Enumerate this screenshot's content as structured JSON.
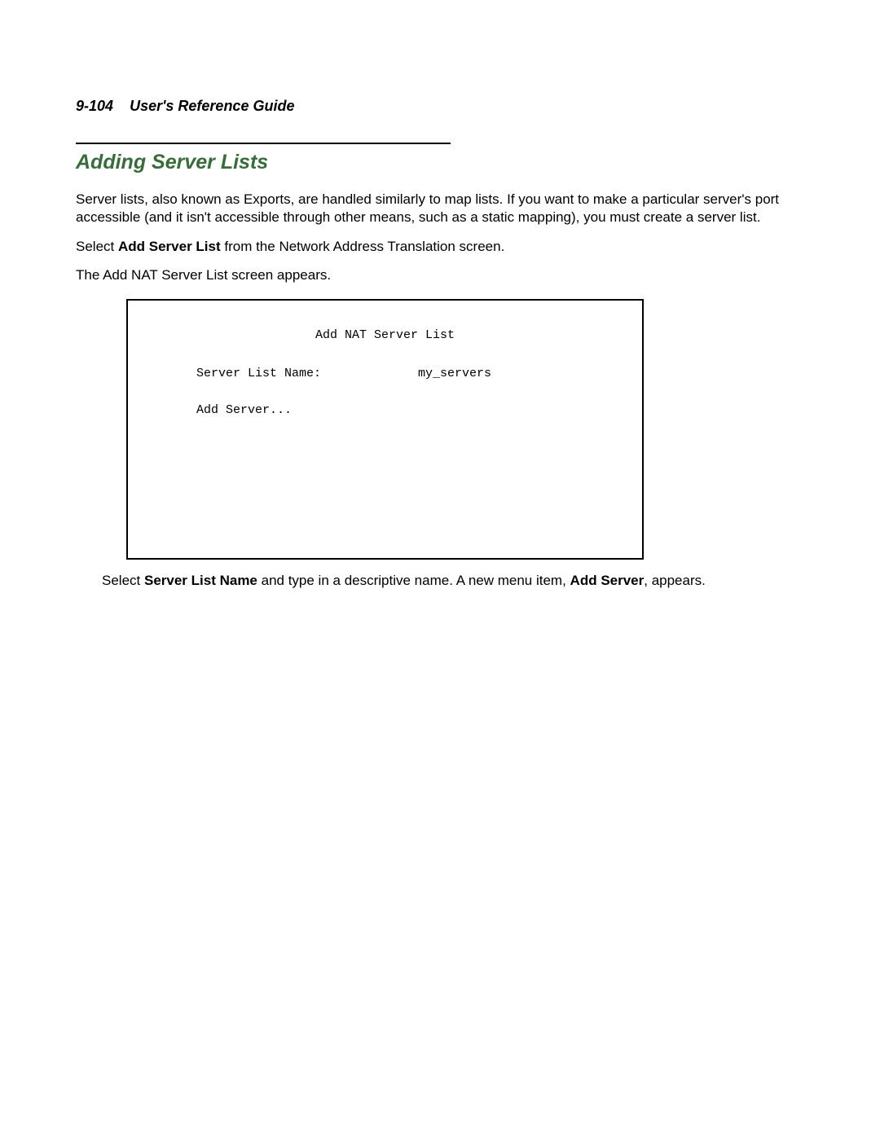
{
  "header": {
    "page_ref": "9-104",
    "doc_title": "User's Reference Guide"
  },
  "section": {
    "title": "Adding Server Lists"
  },
  "paragraphs": {
    "intro": "Server lists, also known as Exports, are handled similarly to map lists. If you want to make a particular server's port accessible (and it isn't accessible through other means, such as a static mapping), you must create a server list.",
    "select_prefix": "Select ",
    "select_bold": "Add Server List",
    "select_suffix": " from the Network Address Translation screen.",
    "appears": "The Add NAT Server List screen appears."
  },
  "console": {
    "title": "Add NAT Server List",
    "field_label": "Server List Name:",
    "field_value": "my_servers",
    "menu_item": "Add Server..."
  },
  "instruction": {
    "prefix": "Select ",
    "bold1": "Server List Name",
    "mid": " and type in a descriptive name. A new menu item, ",
    "bold2": "Add Server",
    "suffix": ", appears."
  }
}
